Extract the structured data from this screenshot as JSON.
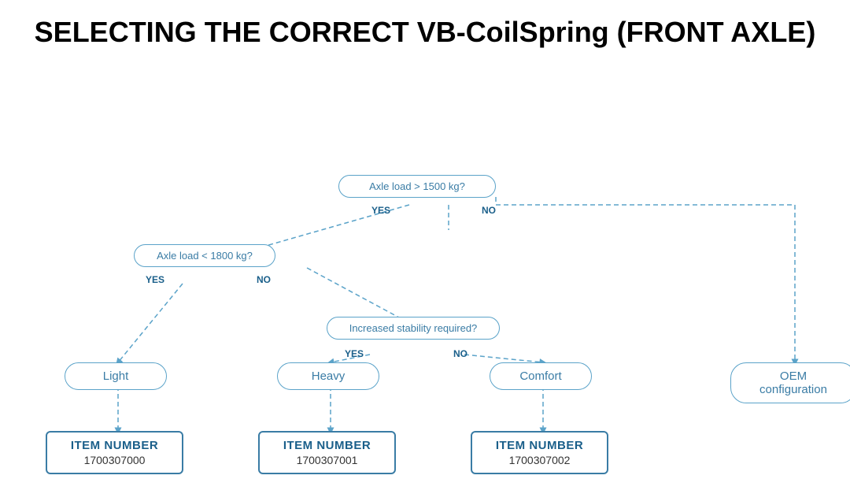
{
  "title": "SELECTING THE CORRECT VB-CoilSpring (FRONT AXLE)",
  "diagram": {
    "decision1": {
      "text": "Axle load > 1500 kg?",
      "yes": "YES",
      "no": "NO"
    },
    "decision2": {
      "text": "Axle load < 1800 kg?",
      "yes": "YES",
      "no": "NO"
    },
    "decision3": {
      "text": "Increased stability required?",
      "yes": "YES",
      "no": "NO"
    },
    "results": {
      "light": "Light",
      "heavy": "Heavy",
      "comfort": "Comfort",
      "oem": "OEM configuration"
    },
    "items": {
      "item1": {
        "label": "ITEM NUMBER",
        "number": "1700307000"
      },
      "item2": {
        "label": "ITEM NUMBER",
        "number": "1700307001"
      },
      "item3": {
        "label": "ITEM NUMBER",
        "number": "1700307002"
      }
    }
  }
}
